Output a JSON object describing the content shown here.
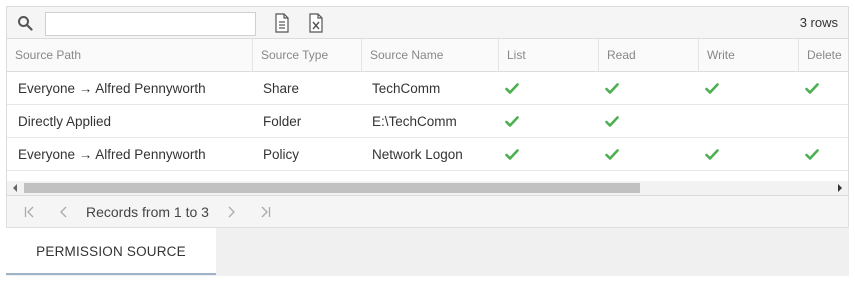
{
  "toolbar": {
    "search_placeholder": "",
    "search_value": "",
    "row_count": "3 rows",
    "icons": {
      "search": "search-icon",
      "export_text": "text-file-icon",
      "export_excel": "excel-file-icon"
    }
  },
  "table": {
    "columns": [
      "Source Path",
      "Source Type",
      "Source Name",
      "List",
      "Read",
      "Write",
      "Delete"
    ],
    "rows": [
      {
        "source_path": "Everyone → Alfred Pennyworth",
        "source_type": "Share",
        "source_name": "TechComm",
        "list": true,
        "read": true,
        "write": true,
        "delete": true
      },
      {
        "source_path": "Directly Applied",
        "source_type": "Folder",
        "source_name": "E:\\TechComm",
        "list": true,
        "read": true,
        "write": false,
        "delete": false
      },
      {
        "source_path": "Everyone → Alfred Pennyworth",
        "source_type": "Policy",
        "source_name": "Network Logon",
        "list": true,
        "read": true,
        "write": true,
        "delete": true
      }
    ]
  },
  "pager": {
    "records_text": "Records from 1 to 3"
  },
  "tabs": [
    {
      "label": "PERMISSION SOURCE",
      "active": true
    }
  ],
  "colors": {
    "check": "#4caf50",
    "tab_underline": "#9fb4c8",
    "header_text": "#888888"
  }
}
